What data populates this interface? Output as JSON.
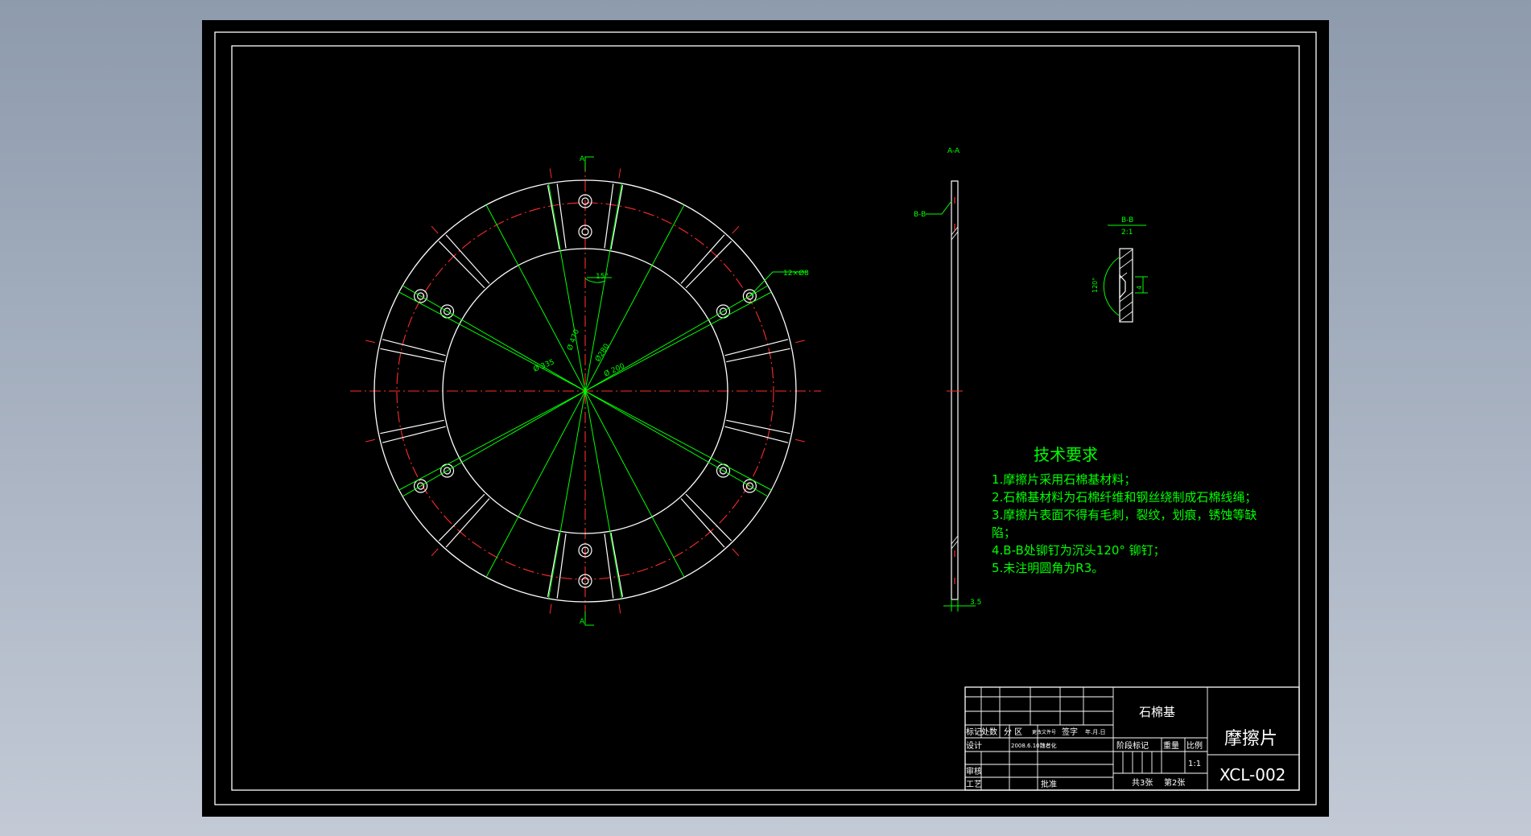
{
  "drawing": {
    "section_labels": {
      "aa_top": "A",
      "aa_bottom": "A",
      "aa_view": "A-A",
      "bb_callout": "B-B",
      "bb_detail": "B-B",
      "bb_scale": "2:1"
    },
    "dimensions": {
      "hole_pattern": "12×Ø8",
      "angle_15": "15°",
      "d_inner": "Ø 200",
      "d_outer": "Ø 335",
      "d_470": "Ø 470",
      "d_280": "Ø280",
      "thickness": "3.5",
      "countersink": "120°",
      "depth": "4"
    },
    "tech_requirements": {
      "title": "技术要求",
      "items": [
        "1.摩擦片采用石棉基材料；",
        "2.石棉基材料为石棉纤维和钢丝绕制成石棉线绳；",
        "3.摩擦片表面不得有毛刺，裂纹，划痕，锈蚀等缺",
        "陷；",
        "4.B-B处铆钉为沉头120° 铆钉；",
        "5.未注明圆角为R3。"
      ]
    }
  },
  "title_block": {
    "material": "石棉基",
    "part_name": "摩擦片",
    "drawing_number": "XCL-002",
    "row_labels": {
      "mark": "标记",
      "count": "处数",
      "zone": "分 区",
      "doc_no": "更改文件号",
      "signature": "签字",
      "date": "年.月.日",
      "design": "设计",
      "design_info": "2008.6.10魏者化",
      "check": "审核",
      "process": "工艺",
      "approve": "批准"
    },
    "stage_mark": "阶段标记",
    "weight": "重量",
    "ratio": "比例",
    "scale_value": "1:1",
    "sheets": "共3张",
    "sheet_no": "第2张"
  },
  "colors": {
    "background": "#000000",
    "outline": "#ffffff",
    "centerline": "#ff2b2b",
    "dimension": "#00ff00",
    "text": "#00ff00"
  }
}
